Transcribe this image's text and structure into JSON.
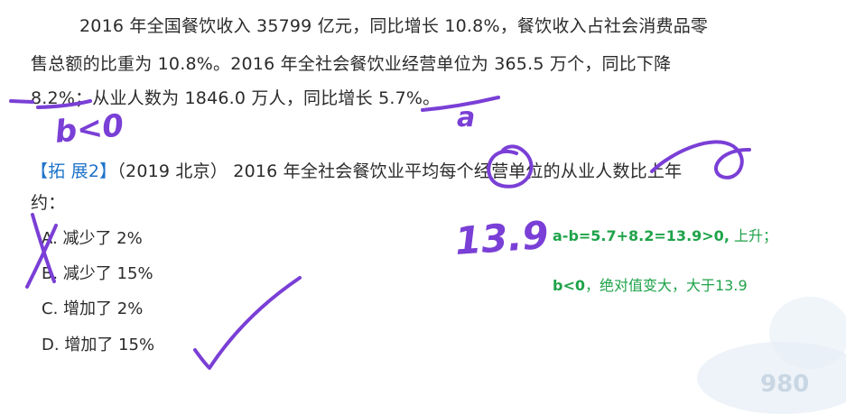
{
  "passage": {
    "line1": "2016 年全国餐饮收入 35799 亿元，同比增长 10.8%，餐饮收入占社会消费品零",
    "line2": "售总额的比重为 10.8%。2016 年全社会餐饮业经营单位为 365.5 万个，同比下降",
    "line3": "8.2%；从业人数为 1846.0 万人，同比增长 5.7%。"
  },
  "question": {
    "tag": "【拓 展2】",
    "text": "（2019 北京） 2016 年全社会餐饮业平均每个经营单位的从业人数比上年",
    "text2": "约："
  },
  "options": [
    {
      "letter": "A.",
      "text": "减少了 2%"
    },
    {
      "letter": "B.",
      "text": "减少了 15%"
    },
    {
      "letter": "C.",
      "text": "增加了 2%"
    },
    {
      "letter": "D.",
      "text": "增加了 15%"
    }
  ],
  "handwriting": {
    "b_label": "b<0",
    "a_label": "a",
    "value": "13.9"
  },
  "notes": {
    "line1_bold": "a-b=5.7+8.2=13.9>0,",
    "line1_rest": " 上升；",
    "line2_bold": "b<0",
    "line2_rest": "，绝对值变大，大于13.9"
  },
  "colors": {
    "ink": "#7a3fd6",
    "note_green": "#1fa34a",
    "tag_blue": "#1e73c9"
  }
}
